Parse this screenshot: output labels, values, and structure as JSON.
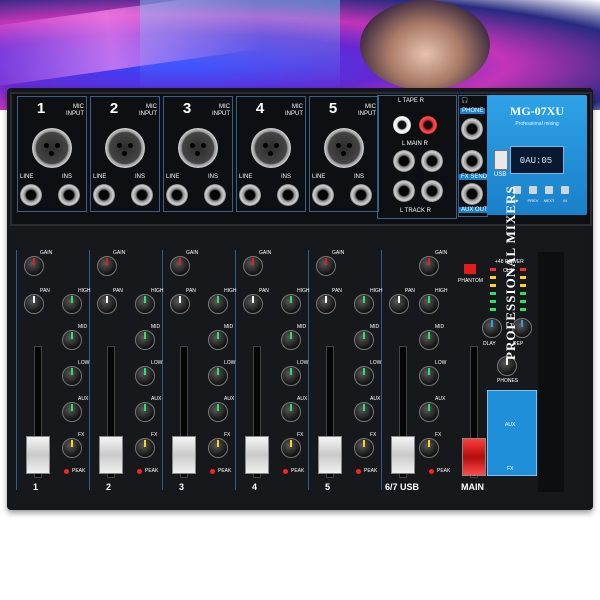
{
  "brand_model": "MG-07XU",
  "brand_subtitle": "Professional mixing",
  "side_title": "PROFESSIONAL MIXERS",
  "display_text": "0AU:05",
  "channels": [
    {
      "num": "1",
      "mic_label": "MIC\nINPUT",
      "line": "LINE",
      "ins": "INS"
    },
    {
      "num": "2",
      "mic_label": "MIC\nINPUT",
      "line": "LINE",
      "ins": "INS"
    },
    {
      "num": "3",
      "mic_label": "MIC\nINPUT",
      "line": "LINE",
      "ins": "INS"
    },
    {
      "num": "4",
      "mic_label": "MIC\nINPUT",
      "line": "LINE",
      "ins": "INS"
    },
    {
      "num": "5",
      "mic_label": "MIC\nINPUT",
      "line": "LINE",
      "ins": "INS"
    }
  ],
  "io_labels": {
    "tape": "L TAPE R",
    "main": "L MAIN R",
    "track": "L TRACK R",
    "phone": "PHONE",
    "fx_send": "FX SEND",
    "aux_out": "AUX OUT",
    "usb": "USB"
  },
  "panel_buttons": [
    "▶",
    "PREV",
    "NEXT",
    "M"
  ],
  "strip_labels": {
    "gain": "GAIN",
    "pan": "PAN",
    "high": "HIGH",
    "mid": "MID",
    "low": "LOW",
    "aux": "AUX",
    "fx": "FX",
    "peak": "PEAK"
  },
  "bottom_channels": [
    "1",
    "2",
    "3",
    "4",
    "5",
    "6/7 USB"
  ],
  "master_labels": {
    "main": "MAIN",
    "phantom": "PHANTOM",
    "power": "+48 POWER",
    "clip": "CLIP",
    "dly": "DLAY",
    "rep": "REP",
    "phones": "PHONES",
    "aux": "AUX",
    "fx": "FX"
  },
  "colors": {
    "accent": "#1e8fd8",
    "peak": "#ff2020",
    "fader": "#e6e6e6",
    "main_fader": "#e02020"
  }
}
